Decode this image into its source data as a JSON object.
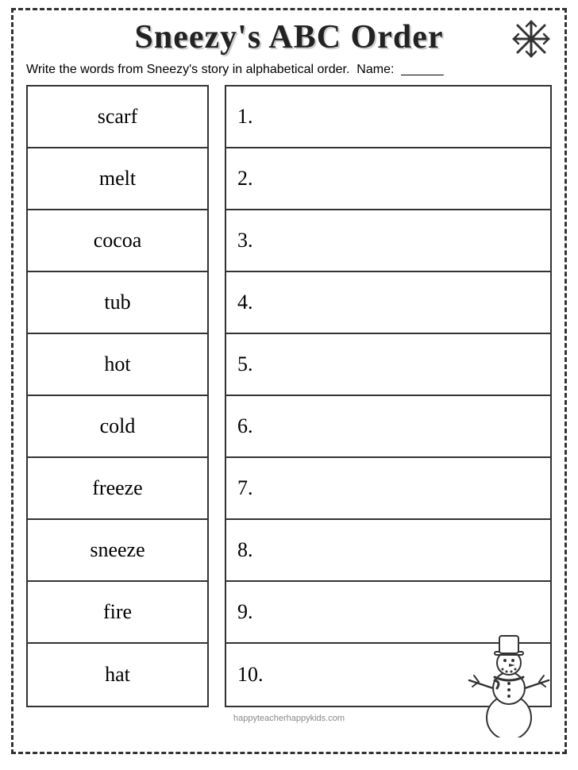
{
  "title": "Sneezy's ABC Order",
  "instructions": "Write the words from Sneezy's story in alphabetical order.",
  "name_label": "Name:",
  "name_blank": "______",
  "words": [
    "scarf",
    "melt",
    "cocoa",
    "tub",
    "hot",
    "cold",
    "freeze",
    "sneeze",
    "fire",
    "hat"
  ],
  "answer_numbers": [
    "1.",
    "2.",
    "3.",
    "4.",
    "5.",
    "6.",
    "7.",
    "8.",
    "9.",
    "10."
  ],
  "footer": "happyteacherhappykids.com"
}
